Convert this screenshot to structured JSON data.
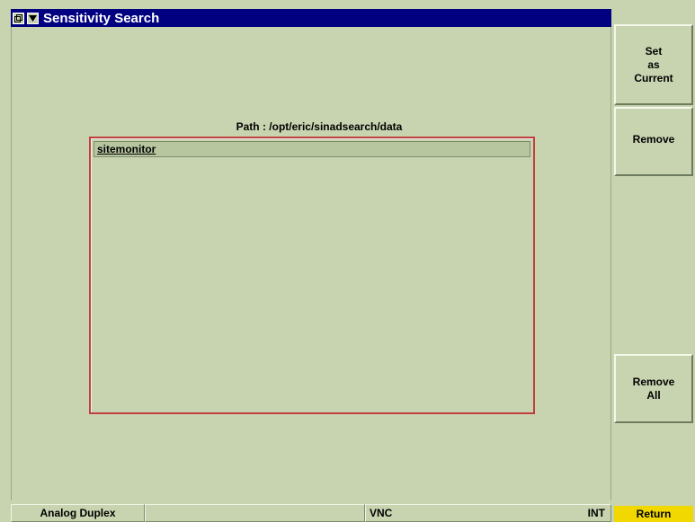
{
  "window": {
    "title": "Sensitivity Search"
  },
  "main": {
    "path_label": "Path : /opt/eric/sinadsearch/data",
    "files": [
      {
        "name": "sitemonitor"
      }
    ]
  },
  "softkeys": {
    "set_current": [
      "Set",
      "as",
      "Current"
    ],
    "remove": "Remove",
    "remove_all": [
      "Remove",
      "All"
    ],
    "return": "Return"
  },
  "statusbar": {
    "mode": "Analog Duplex",
    "empty": "",
    "vnc": "VNC",
    "int": "INT"
  },
  "colors": {
    "background": "#c8d4b0",
    "titlebar": "#000080",
    "list_border": "#c04040",
    "return_key": "#f0d800"
  },
  "icons": {
    "restore": "restore-window-icon",
    "menu": "dropdown-menu-icon"
  }
}
